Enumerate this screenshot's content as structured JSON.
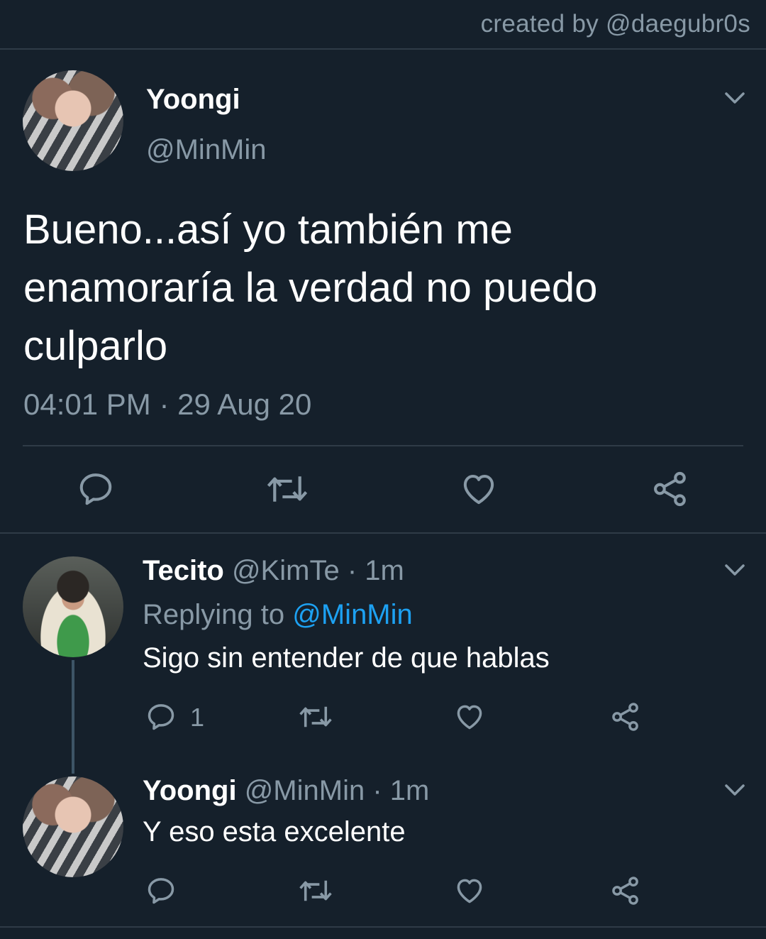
{
  "credit": "created by @daegubr0s",
  "main_tweet": {
    "name": "Yoongi",
    "handle": "@MinMin",
    "text_line1": "Bueno...así yo también me",
    "text_line2": "enamoraría la verdad no puedo",
    "text_line3": "culparlo",
    "time": "04:01 PM",
    "separator": "·",
    "date": "29 Aug 20",
    "icons": [
      "reply-icon",
      "retweet-icon",
      "like-icon",
      "share-icon"
    ]
  },
  "replies": [
    {
      "name": "Tecito",
      "handle": "@KimTe",
      "separator": "·",
      "time": "1m",
      "replying_prefix": "Replying to",
      "replying_handle": "@MinMin",
      "text": "Sigo sin entender de que hablas",
      "reply_count": "1"
    },
    {
      "name": "Yoongi",
      "handle": "@MinMin",
      "separator": "·",
      "time": "1m",
      "text": "Y eso esta excelente"
    }
  ]
}
